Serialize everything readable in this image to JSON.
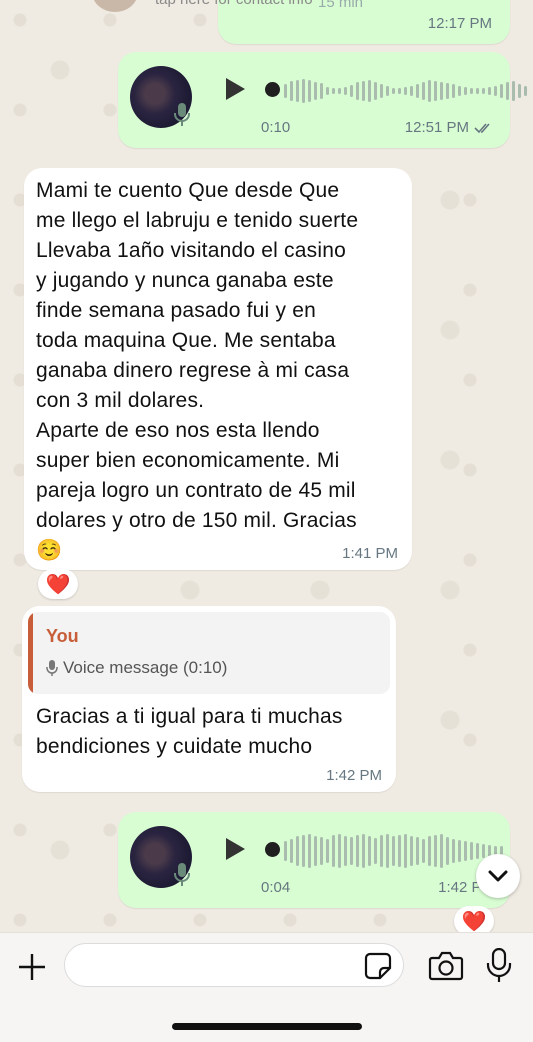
{
  "header": {
    "contact_hint": "tap here for contact info"
  },
  "messages": [
    {
      "kind": "voice",
      "direction": "outgoing",
      "partial": true,
      "faded_text": "15 min",
      "time": "12:17 PM"
    },
    {
      "kind": "voice",
      "direction": "outgoing",
      "duration": "0:10",
      "time": "12:51 PM",
      "status": "read",
      "waveform_heights": [
        14,
        20,
        22,
        24,
        22,
        18,
        16,
        8,
        6,
        6,
        8,
        12,
        18,
        20,
        22,
        18,
        14,
        10,
        6,
        6,
        8,
        10,
        14,
        18,
        22,
        20,
        18,
        16,
        14,
        10,
        8,
        6,
        6,
        6,
        8,
        10,
        14,
        18,
        20,
        14,
        10
      ]
    },
    {
      "kind": "text",
      "direction": "incoming",
      "text": "Mami te cuento Que desde Que\nme llego el labruju e tenido suerte\nLlevaba 1año visitando  el casino\ny jugando y nunca ganaba este\nfinde semana pasado fui y en\ntoda maquina Que. Me sentaba\nganaba dinero regrese à mi casa\ncon 3 mil dolares.\nAparte de eso nos esta llendo\nsuper bien economicamente. Mi\npareja logro un contrato de 45 mil\ndolares y otro de 150 mil. Gracias\n☺️",
      "time": "1:41 PM",
      "reaction": "❤️"
    },
    {
      "kind": "reply",
      "direction": "incoming",
      "quoted_author": "You",
      "quoted_preview": "Voice message (0:10)",
      "text": "Gracias a ti igual para ti muchas\nbendiciones y cuidate mucho",
      "time": "1:42 PM"
    },
    {
      "kind": "voice",
      "direction": "outgoing",
      "duration": "0:04",
      "time": "1:42 PM",
      "reaction": "❤️",
      "waveform_heights": [
        20,
        24,
        30,
        32,
        34,
        30,
        28,
        24,
        32,
        34,
        30,
        28,
        32,
        34,
        30,
        26,
        32,
        34,
        30,
        32,
        34,
        30,
        28,
        24,
        30,
        32,
        34,
        28,
        24,
        22,
        20,
        18,
        16,
        14,
        12,
        10,
        10
      ]
    }
  ],
  "composer": {
    "placeholder": ""
  },
  "icons": {
    "play": "play-icon",
    "mic": "microphone-icon",
    "read_ticks": "double-check-icon",
    "plus": "plus-icon",
    "sticker": "sticker-icon",
    "camera": "camera-icon",
    "scroll_down": "chevron-down-icon"
  },
  "colors": {
    "outgoing_bubble": "#d9fdd3",
    "incoming_bubble": "#ffffff",
    "quote_accent": "#c75d39",
    "reaction_heart": "#e11d2c",
    "background": "#efeae2"
  }
}
